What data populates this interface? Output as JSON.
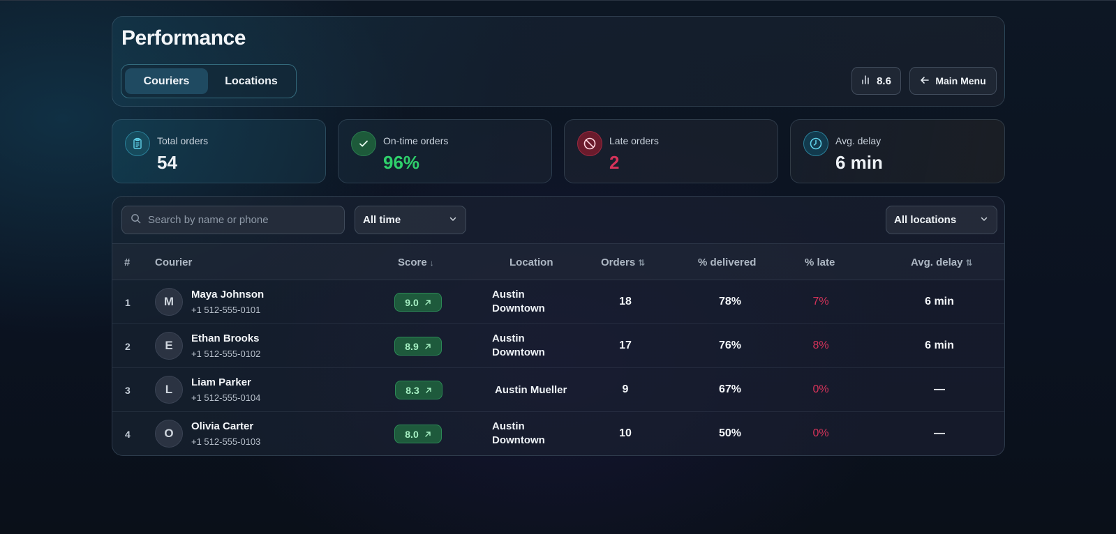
{
  "header": {
    "title": "Performance",
    "tabs": [
      {
        "label": "Couriers",
        "active": true
      },
      {
        "label": "Locations",
        "active": false
      }
    ],
    "score_chip": {
      "icon": "bar-chart-icon",
      "value": "8.6"
    },
    "main_menu": {
      "icon": "arrow-left-icon",
      "label": "Main Menu"
    }
  },
  "stats": {
    "total": {
      "label": "Total orders",
      "value": "54",
      "icon": "clipboard-icon",
      "color": "#eef2f6"
    },
    "ontime": {
      "label": "On-time orders",
      "value": "96%",
      "icon": "check-icon",
      "color": "#2fd06b"
    },
    "late": {
      "label": "Late orders",
      "value": "2",
      "icon": "ban-icon",
      "color": "#d6335a"
    },
    "delay": {
      "label": "Avg. delay",
      "value": "6 min",
      "icon": "clock-icon",
      "color": "#eef2f6"
    }
  },
  "filters": {
    "search_placeholder": "Search by name or phone",
    "search_value": "",
    "time": "All time",
    "location": "All locations"
  },
  "table": {
    "columns": {
      "idx": "#",
      "courier": "Courier",
      "score": "Score",
      "location": "Location",
      "orders": "Orders",
      "delivered": "% delivered",
      "late": "% late",
      "delay": "Avg. delay"
    },
    "rows": [
      {
        "idx": "1",
        "initial": "M",
        "name": "Maya Johnson",
        "phone": "+1 512-555-0101",
        "score": "9.0",
        "location_l1": "Austin",
        "location_l2": "Downtown",
        "orders": "18",
        "delivered": "78%",
        "late": "7%",
        "delay": "6 min"
      },
      {
        "idx": "2",
        "initial": "E",
        "name": "Ethan Brooks",
        "phone": "+1 512-555-0102",
        "score": "8.9",
        "location_l1": "Austin",
        "location_l2": "Downtown",
        "orders": "17",
        "delivered": "76%",
        "late": "8%",
        "delay": "6 min"
      },
      {
        "idx": "3",
        "initial": "L",
        "name": "Liam Parker",
        "phone": "+1 512-555-0104",
        "score": "8.3",
        "location_l1": "Austin Mueller",
        "location_l2": "",
        "orders": "9",
        "delivered": "67%",
        "late": "0%",
        "delay": "—"
      },
      {
        "idx": "4",
        "initial": "O",
        "name": "Olivia Carter",
        "phone": "+1 512-555-0103",
        "score": "8.0",
        "location_l1": "Austin",
        "location_l2": "Downtown",
        "orders": "10",
        "delivered": "50%",
        "late": "0%",
        "delay": "—"
      }
    ]
  },
  "colors": {
    "accent": "#1f4a61",
    "success": "#2fd06b",
    "danger": "#d6335a"
  }
}
